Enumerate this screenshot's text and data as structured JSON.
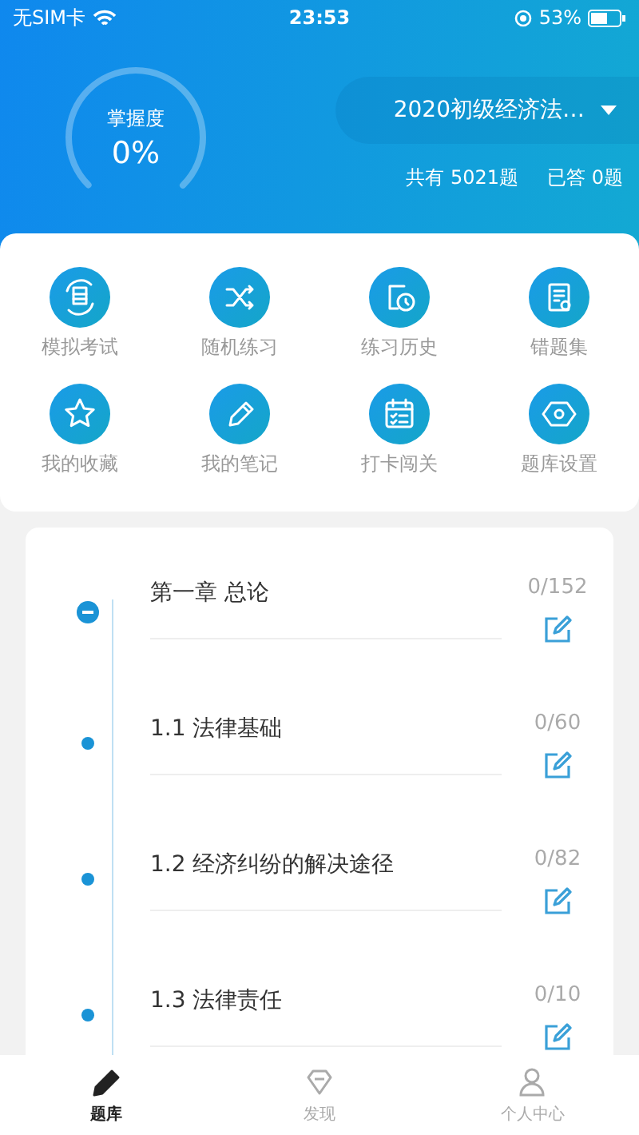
{
  "status_bar": {
    "carrier": "无SIM卡",
    "time": "23:53",
    "battery": "53%"
  },
  "header": {
    "gauge": {
      "label": "掌握度",
      "value": "0%"
    },
    "bank": {
      "title": "2020初级经济法…"
    },
    "total": "共有 5021题",
    "answered": "已答 0题"
  },
  "shortcuts": [
    {
      "label": "模拟考试"
    },
    {
      "label": "随机练习"
    },
    {
      "label": "练习历史"
    },
    {
      "label": "错题集"
    },
    {
      "label": "我的收藏"
    },
    {
      "label": "我的笔记"
    },
    {
      "label": "打卡闯关"
    },
    {
      "label": "题库设置"
    }
  ],
  "chapters": [
    {
      "kind": "chapter",
      "expanded": true,
      "title": "第一章 总论",
      "count": "0/152"
    },
    {
      "kind": "section",
      "title": "1.1 法律基础",
      "count": "0/60"
    },
    {
      "kind": "section",
      "title": "1.2 经济纠纷的解决途径",
      "count": "0/82"
    },
    {
      "kind": "section",
      "title": "1.3 法律责任",
      "count": "0/10"
    }
  ],
  "tab_bar": [
    {
      "label": "题库",
      "selected": true
    },
    {
      "label": "发现",
      "selected": false
    },
    {
      "label": "个人中心",
      "selected": false
    }
  ]
}
